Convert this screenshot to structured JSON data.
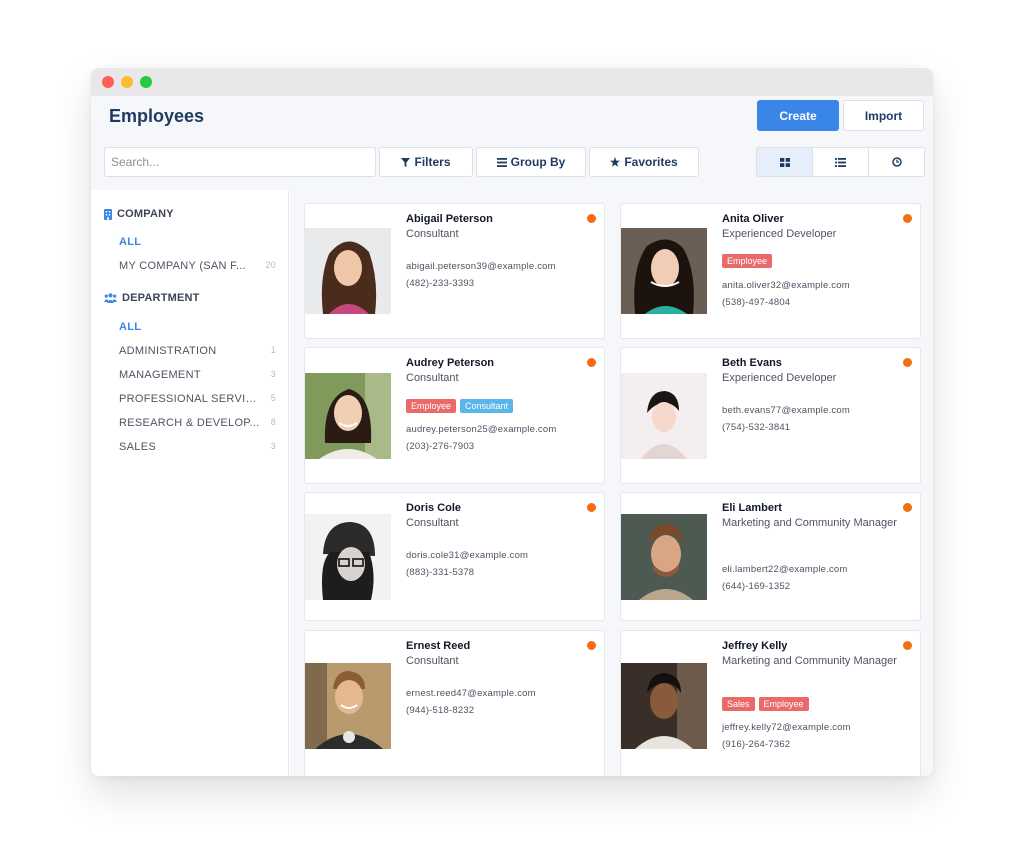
{
  "title": "Employees",
  "actions": {
    "create": "Create",
    "import": "Import"
  },
  "search": {
    "placeholder": "Search..."
  },
  "filters": {
    "filters": "Filters",
    "group_by": "Group By",
    "favorites": "Favorites"
  },
  "views": [
    "kanban-view",
    "list-view",
    "activity-view"
  ],
  "sidebar": {
    "company": {
      "header": "COMPANY",
      "items": [
        {
          "label": "ALL",
          "count": ""
        },
        {
          "label": "MY COMPANY (SAN F...",
          "count": "20"
        }
      ]
    },
    "department": {
      "header": "DEPARTMENT",
      "items": [
        {
          "label": "ALL",
          "count": ""
        },
        {
          "label": "ADMINISTRATION",
          "count": "1"
        },
        {
          "label": "MANAGEMENT",
          "count": "3"
        },
        {
          "label": "PROFESSIONAL SERVIC...",
          "count": "5"
        },
        {
          "label": "RESEARCH & DEVELOP...",
          "count": "8"
        },
        {
          "label": "SALES",
          "count": "3"
        }
      ]
    }
  },
  "cards": [
    {
      "name": "Abigail Peterson",
      "job": "Consultant",
      "tags": [],
      "email": "abigail.peterson39@example.com",
      "phone": "(482)-233-3393"
    },
    {
      "name": "Anita Oliver",
      "job": "Experienced Developer",
      "tags": [
        "Employee"
      ],
      "email": "anita.oliver32@example.com",
      "phone": "(538)-497-4804"
    },
    {
      "name": "Audrey Peterson",
      "job": "Consultant",
      "tags": [
        "Employee",
        "Consultant"
      ],
      "email": "audrey.peterson25@example.com",
      "phone": "(203)-276-7903"
    },
    {
      "name": "Beth Evans",
      "job": "Experienced Developer",
      "tags": [],
      "email": "beth.evans77@example.com",
      "phone": "(754)-532-3841"
    },
    {
      "name": "Doris Cole",
      "job": "Consultant",
      "tags": [],
      "email": "doris.cole31@example.com",
      "phone": "(883)-331-5378"
    },
    {
      "name": "Eli Lambert",
      "job": "Marketing and Community Manager",
      "tags": [],
      "email": "eli.lambert22@example.com",
      "phone": "(644)-169-1352"
    },
    {
      "name": "Ernest Reed",
      "job": "Consultant",
      "tags": [],
      "email": "ernest.reed47@example.com",
      "phone": "(944)-518-8232"
    },
    {
      "name": "Jeffrey Kelly",
      "job": "Marketing and Community Manager",
      "tags": [
        "Sales",
        "Employee"
      ],
      "email": "jeffrey.kelly72@example.com",
      "phone": "(916)-264-7362"
    }
  ],
  "colors": {
    "accent": "#3a86e8",
    "status": "#f36d14",
    "tag_red": "#ea6a6a",
    "tag_blue": "#5ab5ea"
  }
}
